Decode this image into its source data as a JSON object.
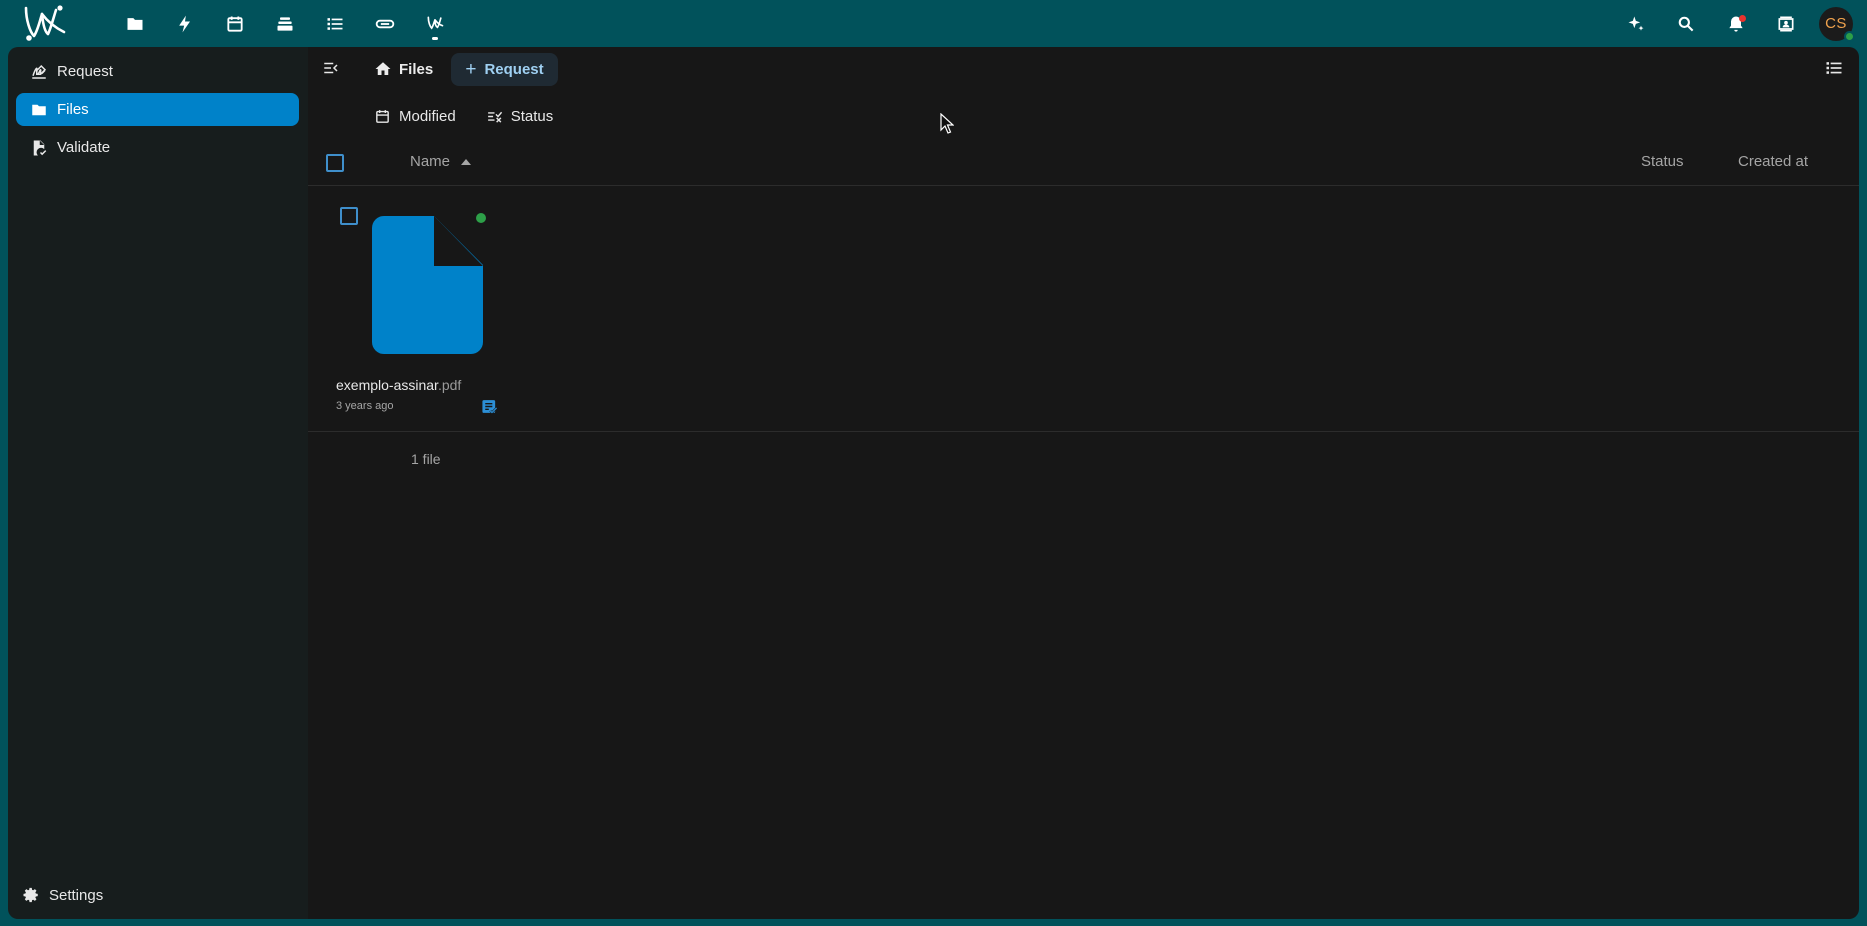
{
  "topbar": {
    "apps": [
      {
        "name": "files-app",
        "icon": "folder-icon"
      },
      {
        "name": "activity-app",
        "icon": "lightning-icon"
      },
      {
        "name": "calendar-app",
        "icon": "calendar-icon"
      },
      {
        "name": "deck-app",
        "icon": "stack-icon"
      },
      {
        "name": "tasks-app",
        "icon": "list-icon"
      },
      {
        "name": "link-app",
        "icon": "link-icon"
      },
      {
        "name": "libresign-app",
        "icon": "libresign-icon"
      }
    ],
    "avatar_initials": "CS",
    "accent_color": "#01525b"
  },
  "sidebar": {
    "items": [
      {
        "label": "Request",
        "icon": "signature-icon"
      },
      {
        "label": "Files",
        "icon": "folder-icon",
        "active": true
      },
      {
        "label": "Validate",
        "icon": "file-check-icon"
      }
    ],
    "settings_label": "Settings",
    "active_color": "#0082c9"
  },
  "main": {
    "breadcrumb_home": "Files",
    "new_button_label": "Request",
    "filters": [
      {
        "label": "Modified",
        "icon": "calendar-icon"
      },
      {
        "label": "Status",
        "icon": "checklist-icon"
      }
    ],
    "columns": {
      "name": "Name",
      "status": "Status",
      "created_at": "Created at"
    },
    "files": [
      {
        "basename": "exemplo-assinar",
        "extension": ".pdf",
        "modified": "3 years ago",
        "status_color": "#2d9f48"
      }
    ],
    "summary": "1 file"
  }
}
